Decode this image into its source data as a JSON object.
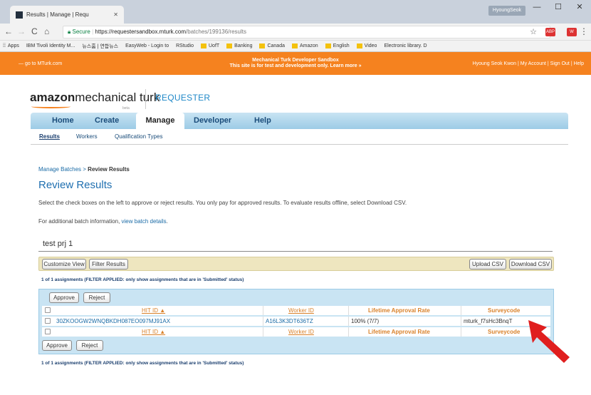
{
  "browser": {
    "tab_title": "Results | Manage | Requ",
    "user_chip": "HyoungSeok",
    "url_secure": "Secure",
    "url_host": "https://requestersandbox.mturk.com",
    "url_path": "/batches/199136/results",
    "bookmarks": [
      "Apps",
      "IBM Tivoli Identity M...",
      "뉴스홈 | 연합뉴스",
      "EasyWeb - Login to",
      "RStudio",
      "UofT",
      "Banking",
      "Canada",
      "Amazon",
      "English",
      "Video",
      "Electronic library. D"
    ]
  },
  "topbar": {
    "goto": "— go to MTurk.com",
    "center_line1": "Mechanical Turk Developer Sandbox",
    "center_line2": "This site is for test and development only. Learn more »",
    "right": "Hyoung Seok Kwon | My Account | Sign Out | Help"
  },
  "logo": {
    "amazon": "amazon",
    "mt": "mechanical turk",
    "beta": "beta",
    "requester": "REQUESTER"
  },
  "mainnav": {
    "home": "Home",
    "create": "Create",
    "manage": "Manage",
    "developer": "Developer",
    "help": "Help"
  },
  "subnav": {
    "results": "Results",
    "workers": "Workers",
    "qual": "Qualification Types"
  },
  "content": {
    "crumb_link": "Manage Batches",
    "crumb_sep": " > ",
    "crumb_current": "Review Results",
    "title": "Review Results",
    "desc": "Select the check boxes on the left to approve or reject results. You only pay for approved results. To evaluate results offline, select Download CSV.",
    "desc2_prefix": "For additional batch information, ",
    "desc2_link": "view batch details",
    "desc2_suffix": ".",
    "project_name": "test prj 1"
  },
  "toolbar": {
    "customize": "Customize View",
    "filter": "Filter Results",
    "upload": "Upload CSV",
    "download": "Download CSV"
  },
  "note": "1 of 1 assignments (FILTER APPLIED: only show assignments that are in 'Submitted' status)",
  "table": {
    "approve": "Approve",
    "reject": "Reject",
    "headers": {
      "hit_id": "HIT ID ▲",
      "worker_id": "Worker ID",
      "lifetime": "Lifetime Approval Rate",
      "surveycode": "Surveycode"
    },
    "row": {
      "hit_id": "30ZKOOGW2WNQBKDH087EO097MJ91AX",
      "worker_id": "A16L3K3DT636TZ",
      "lifetime": "100% (7/7)",
      "surveycode": "mturk_f7sHc3BnqT"
    }
  },
  "colors": {
    "orange": "#f5821f",
    "nav_blue": "#9ccbe6",
    "arrow_red": "#e01e1e"
  }
}
